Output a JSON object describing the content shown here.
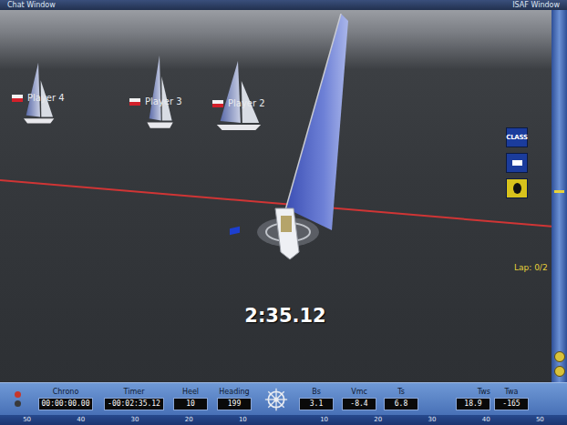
{
  "windows": {
    "chat": "Chat Window",
    "isaf": "ISAF Window"
  },
  "players": [
    {
      "name": "Player 4"
    },
    {
      "name": "Player 3"
    },
    {
      "name": "Player 2"
    }
  ],
  "flags": [
    {
      "kind": "text",
      "text": "CLASS",
      "color": "#1b3c9c"
    },
    {
      "kind": "rect",
      "color": "#1b3c9c"
    },
    {
      "kind": "circle",
      "color": "#d8c21c"
    }
  ],
  "lap": "Lap: 0/2",
  "countdown": "2:35.12",
  "instruments": [
    {
      "label": "Chrono",
      "value": "00:00:00.00"
    },
    {
      "label": "Timer",
      "value": "-00:02:35.12"
    },
    {
      "label": "Heel",
      "value": "10"
    },
    {
      "label": "Heading",
      "value": "199"
    },
    {
      "label": "Bs",
      "value": "3.1"
    },
    {
      "label": "Vmc",
      "value": "-8.4"
    },
    {
      "label": "Ts",
      "value": "6.8"
    },
    {
      "label": "Tws",
      "value": "18.9"
    },
    {
      "label": "Twa",
      "value": "-165"
    }
  ],
  "scale": [
    "50",
    "40",
    "30",
    "20",
    "10",
    "10",
    "20",
    "30",
    "40",
    "50"
  ]
}
